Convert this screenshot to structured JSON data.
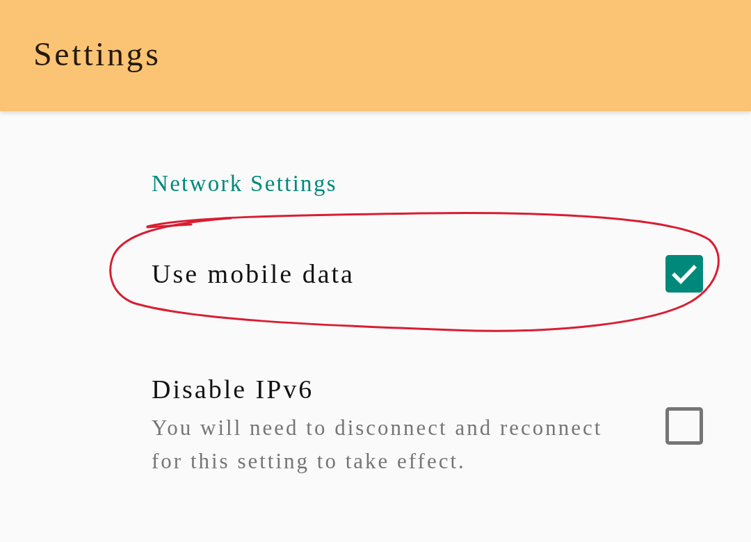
{
  "app_bar": {
    "title": "Settings"
  },
  "category": {
    "title": "Network Settings"
  },
  "items": [
    {
      "title": "Use mobile data",
      "checked": true,
      "circled": true
    },
    {
      "title": "Disable IPv6",
      "summary": "You will need to disconnect and reconnect for this setting to take effect.",
      "checked": false,
      "circled": false
    }
  ]
}
